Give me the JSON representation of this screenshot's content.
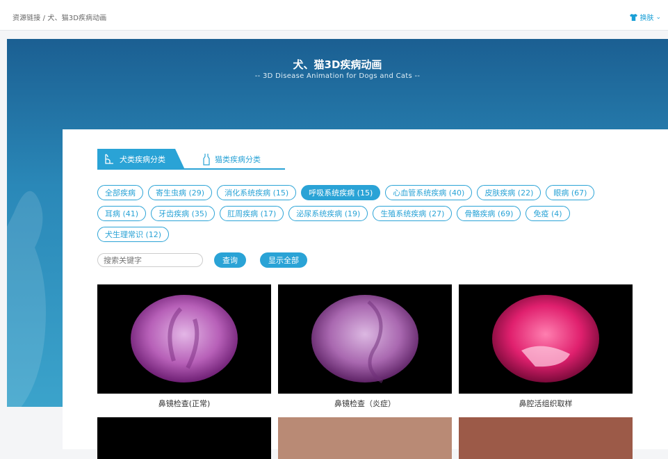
{
  "breadcrumb": "资源链接 / 犬、猫3D疾病动画",
  "skin_label": "换肤",
  "hero": {
    "title": "犬、猫3D疾病动画",
    "subtitle": "-- 3D Disease Animation for Dogs and Cats --"
  },
  "tabs": [
    {
      "label": "犬类疾病分类",
      "active": true
    },
    {
      "label": "猫类疾病分类",
      "active": false
    }
  ],
  "categories_row1": [
    "全部疾病",
    "寄生虫病 (29)",
    "消化系统疾病 (15)",
    "呼吸系统疾病 (15)",
    "心血管系统疾病 (40)",
    "皮肤疾病 (22)",
    "眼病 (67)"
  ],
  "categories_row2": [
    "耳病 (41)",
    "牙齿疾病 (35)",
    "肛周疾病 (17)",
    "泌尿系统疾病 (19)",
    "生殖系统疾病 (27)",
    "骨骼疾病 (69)",
    "免疫 (4)"
  ],
  "categories_row3": [
    "犬生理常识 (12)"
  ],
  "active_category": "呼吸系统疾病 (15)",
  "search": {
    "placeholder": "搜索关键字",
    "query_btn": "查询",
    "show_all_btn": "显示全部"
  },
  "videos": [
    "鼻镜检查(正常)",
    "鼻镜检查（炎症）",
    "鼻腔活组织取样"
  ],
  "colors": {
    "accent": "#2aa3d6"
  }
}
